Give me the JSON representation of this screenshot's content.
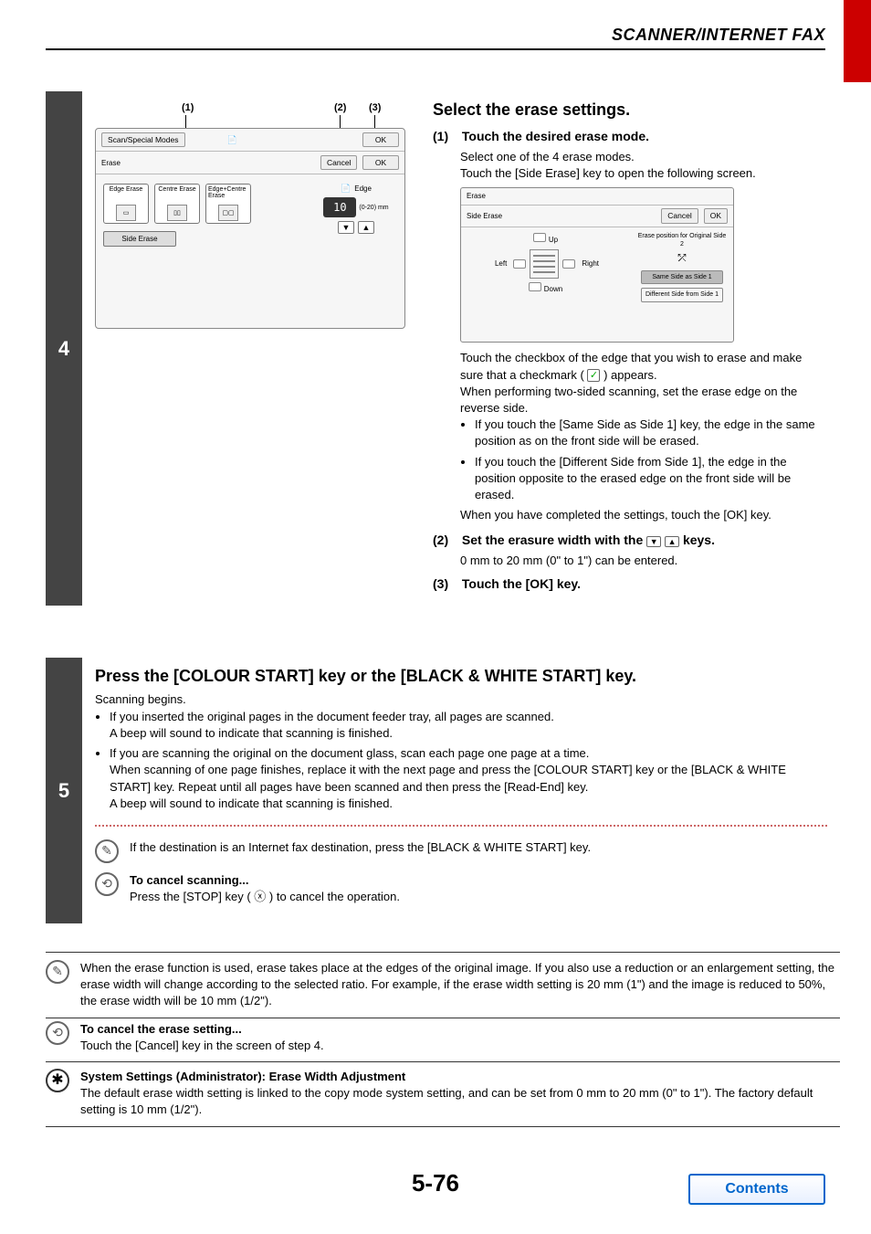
{
  "header": {
    "title": "SCANNER/INTERNET FAX"
  },
  "step4": {
    "num": "4",
    "title": "Select the erase settings.",
    "callouts": {
      "c1": "(1)",
      "c2": "(2)",
      "c3": "(3)"
    },
    "screenshot1": {
      "topLabel": "Scan/Special Modes",
      "subLabel": "Erase",
      "ok": "OK",
      "cancel": "Cancel",
      "modes": {
        "edge": "Edge Erase",
        "centre": "Centre Erase",
        "edgeCentre": "Edge+Centre Erase",
        "side": "Side Erase"
      },
      "edgeLabel": "Edge",
      "widthValue": "10",
      "widthRange": "(0-20) mm"
    },
    "sub1": {
      "num": "(1)",
      "title": "Touch the desired erase mode.",
      "line1": "Select one of the 4 erase modes.",
      "line2": "Touch the [Side Erase] key to open the following screen."
    },
    "screenshot2": {
      "title": "Erase",
      "subtitle": "Side Erase",
      "cancel": "Cancel",
      "ok": "OK",
      "up": "Up",
      "left": "Left",
      "right": "Right",
      "down": "Down",
      "posHdr": "Erase position for Original Side 2",
      "same": "Same Side as Side 1",
      "diff": "Different Side from Side 1"
    },
    "afterSS2": {
      "p1a": "Touch the checkbox of the edge that you wish to erase and make sure that a checkmark (",
      "p1b": ") appears.",
      "p2": "When performing two-sided scanning, set the erase edge on the reverse side.",
      "b1": "If you touch the [Same Side as Side 1] key, the edge in the same position as on the front side will be erased.",
      "b2": "If you touch the [Different Side from Side 1], the edge in the position opposite to the erased edge on the front side will be erased.",
      "p3": "When you have completed the settings, touch the [OK] key."
    },
    "sub2": {
      "num": "(2)",
      "titleA": "Set the erasure width with the ",
      "titleB": " keys.",
      "line1": "0 mm to 20 mm (0\" to 1\") can be entered."
    },
    "sub3": {
      "num": "(3)",
      "title": "Touch the [OK] key."
    }
  },
  "step5": {
    "num": "5",
    "title": "Press the [COLOUR START] key or the [BLACK & WHITE START] key.",
    "line0": "Scanning begins.",
    "b1a": "If you inserted the original pages in the document feeder tray, all pages are scanned.",
    "b1b": "A beep will sound to indicate that scanning is finished.",
    "b2a": "If you are scanning the original on the document glass, scan each page one page at a time.",
    "b2b": "When scanning of one page finishes, replace it with the next page and press the [COLOUR START] key or the [BLACK & WHITE START] key. Repeat until all pages have been scanned and then press the [Read-End] key.",
    "b2c": "A beep will sound to indicate that scanning is finished.",
    "note1": "If the destination is an Internet fax destination, press the [BLACK & WHITE START] key.",
    "note2title": "To cancel scanning...",
    "note2body": "Press the [STOP] key ( ⓧ ) to cancel the operation."
  },
  "info1": "When the erase function is used, erase takes place at the edges of the original image. If you also use a reduction or an enlargement setting, the erase width will change according to the selected ratio. For example, if the erase width setting is 20 mm (1\") and the image is reduced to 50%, the erase width will be 10 mm (1/2\").",
  "info2title": "To cancel the erase setting...",
  "info2body": "Touch the [Cancel] key in the screen of step 4.",
  "info3title": "System Settings (Administrator): Erase Width Adjustment",
  "info3body": "The default erase width setting is linked to the copy mode system setting, and can be set from 0 mm to 20 mm (0\" to 1\"). The factory default setting is 10 mm (1/2\").",
  "pageNum": "5-76",
  "contents": "Contents"
}
